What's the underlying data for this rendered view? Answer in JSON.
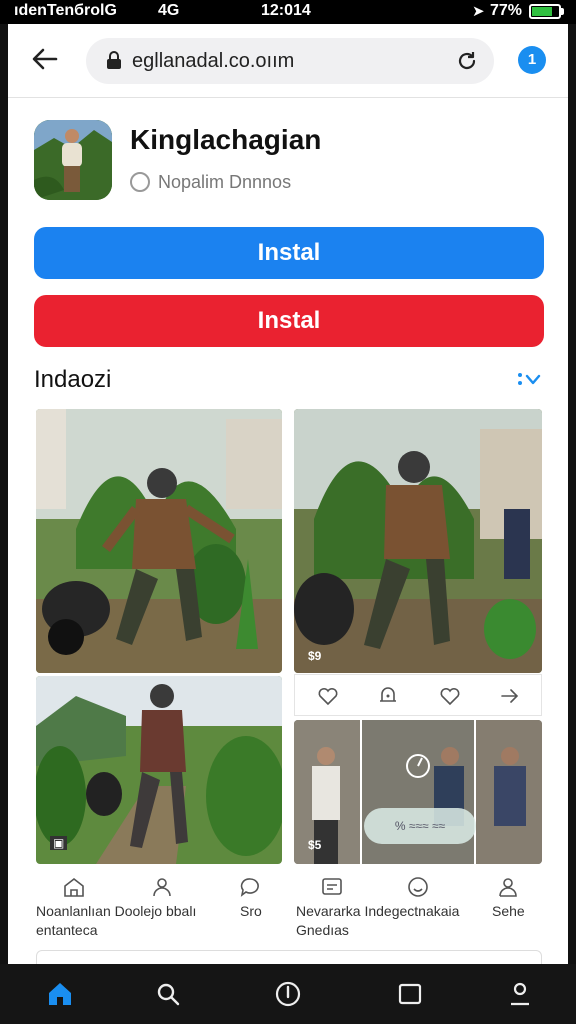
{
  "status_bar": {
    "carrier": "ıdenTenбrolG",
    "network": "4G",
    "time": "12:014",
    "battery_text": "77%",
    "battery_level": 0.77,
    "battery_color": "#30c040"
  },
  "browser": {
    "url": "egllanadal.co.oıım",
    "tab_button": "1",
    "accent": "#1a8ef0"
  },
  "app": {
    "name": "Kinglachagian",
    "subtitle": "Nopalim Dnnnos",
    "install_primary": "Instal",
    "install_secondary": "Instal",
    "primary_color": "#1b82f0",
    "secondary_color": "#ea2230"
  },
  "section": {
    "title": "Indaozi",
    "chevron_icon": "chevron-down-icon"
  },
  "gallery": {
    "badge_1": "$9",
    "badge_2": "$5",
    "overlay_pill": "% ≈≈≈ ≈≈"
  },
  "labels": {
    "left": [
      "Noanlanlıan Doolejo bbalı",
      "entanteca"
    ],
    "mid": "Sro",
    "right": [
      "Nevararka Indegectnakaia",
      "Gnedıas"
    ],
    "far_right": "Sehe"
  },
  "icons": {
    "action_row": [
      "heart-icon",
      "bell-icon",
      "heart-icon",
      "share-icon"
    ],
    "bottom_row": [
      "home-icon",
      "person-icon",
      "heart-icon",
      "message-icon",
      "smile-icon",
      "profile-icon"
    ],
    "nav": [
      "home-icon",
      "search-icon",
      "compass-icon",
      "tabs-icon",
      "profile-icon"
    ]
  }
}
